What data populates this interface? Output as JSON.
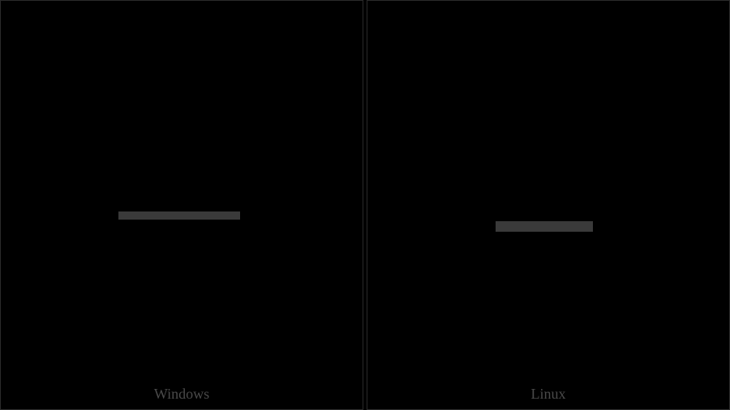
{
  "panels": [
    {
      "label": "Windows"
    },
    {
      "label": "Linux"
    }
  ]
}
